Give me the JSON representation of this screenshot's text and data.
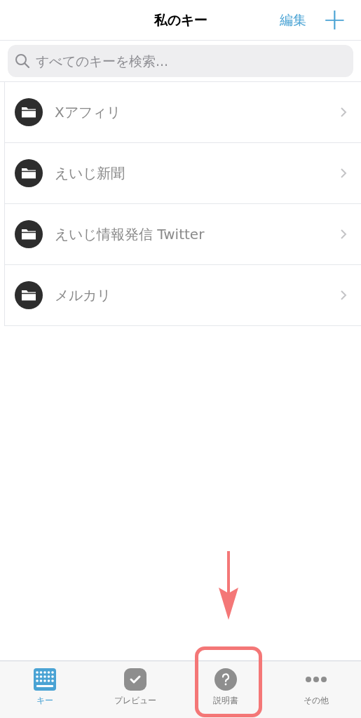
{
  "nav_bar": {
    "title": "私のキー",
    "edit_button": "編集",
    "add_button": "+"
  },
  "search": {
    "placeholder": "すべてのキーを検索..."
  },
  "folders": [
    {
      "name": "Xアフィリ"
    },
    {
      "name": "えいじ新聞"
    },
    {
      "name": "えいじ情報発信 Twitter"
    },
    {
      "name": "メルカリ"
    }
  ],
  "tab_bar": [
    {
      "kind": "keyboard",
      "label": "キー",
      "selected": true,
      "highlighted": false
    },
    {
      "kind": "check",
      "label": "プレビュー",
      "selected": false,
      "highlighted": false
    },
    {
      "kind": "help",
      "label": "説明書",
      "selected": false,
      "highlighted": true
    },
    {
      "kind": "more",
      "label": "その他",
      "selected": false,
      "highlighted": false
    }
  ]
}
